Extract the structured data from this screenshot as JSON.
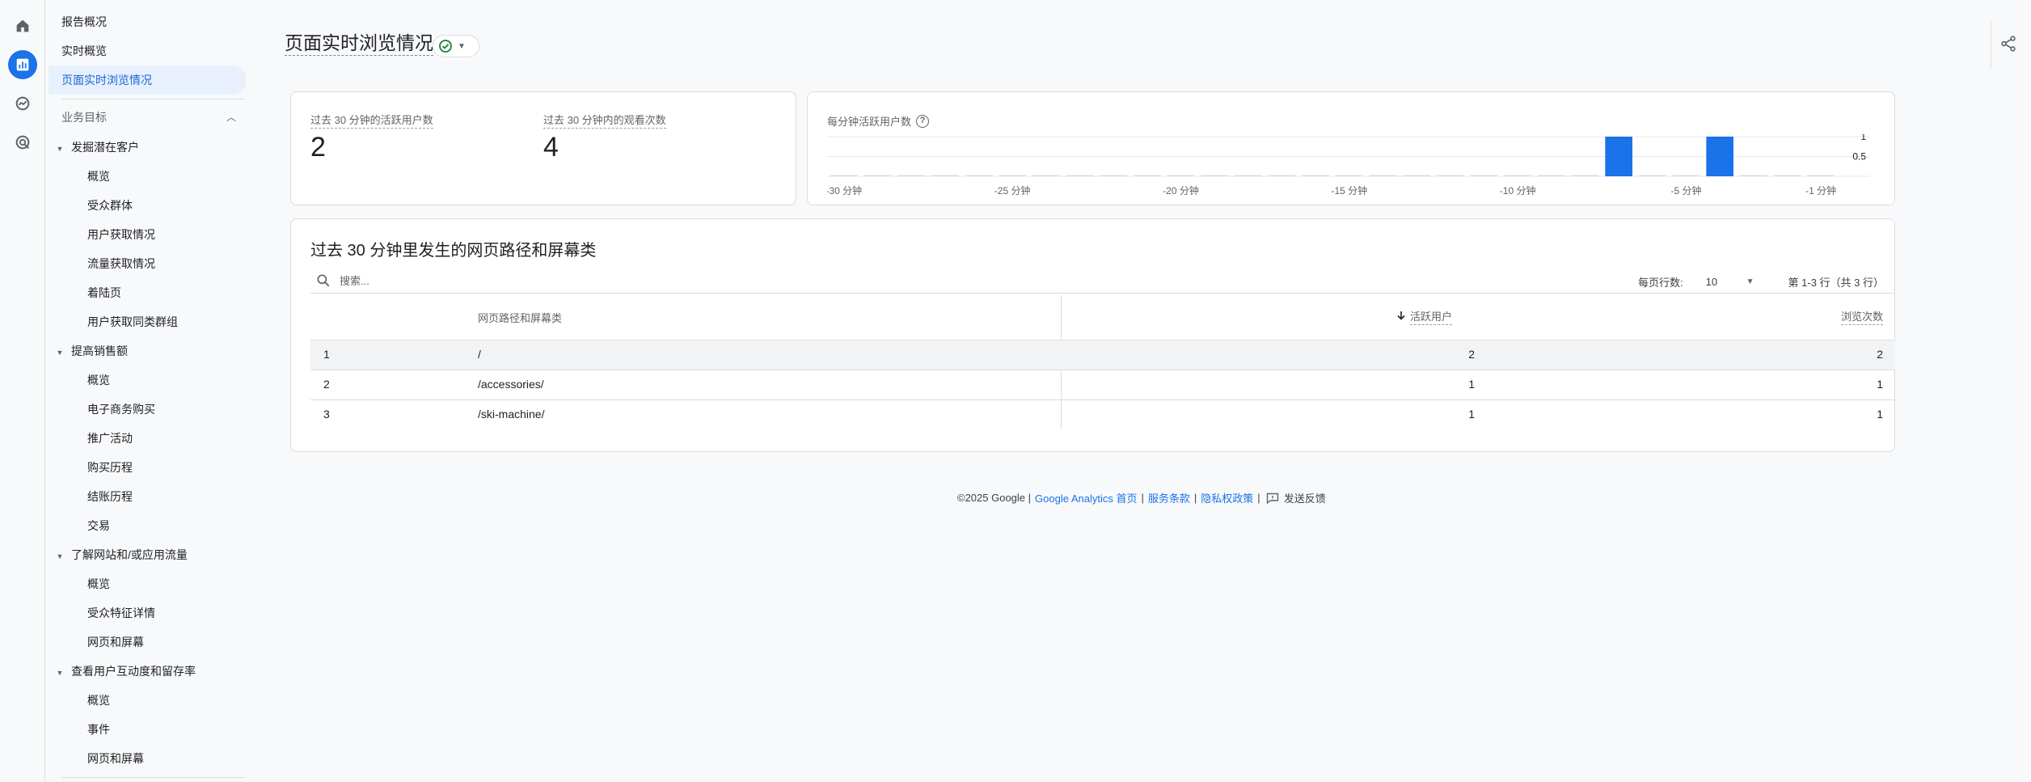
{
  "rail": {
    "icons": [
      "home-icon",
      "reports-icon",
      "explore-icon",
      "advertising-icon"
    ]
  },
  "nav": {
    "top": [
      "报告概况",
      "实时概览",
      "页面实时浏览情况"
    ],
    "section": "业务目标",
    "groups": [
      {
        "label": "发掘潜在客户",
        "items": [
          "概览",
          "受众群体",
          "用户获取情况",
          "流量获取情况",
          "着陆页",
          "用户获取同类群组"
        ]
      },
      {
        "label": "提高销售额",
        "items": [
          "概览",
          "电子商务购买",
          "推广活动",
          "购买历程",
          "结账历程",
          "交易"
        ]
      },
      {
        "label": "了解网站和/或应用流量",
        "items": [
          "概览",
          "受众特征详情",
          "网页和屏幕"
        ]
      },
      {
        "label": "查看用户互动度和留存率",
        "items": [
          "概览",
          "事件",
          "网页和屏幕"
        ]
      }
    ]
  },
  "header": {
    "title": "页面实时浏览情况"
  },
  "metrics": {
    "users_label": "过去 30 分钟的活跃用户数",
    "users_value": "2",
    "views_label": "过去 30 分钟内的观看次数",
    "views_value": "4"
  },
  "chart_data": {
    "type": "bar",
    "title": "每分钟活跃用户数",
    "x": [
      -30,
      -29,
      -28,
      -27,
      -26,
      -25,
      -24,
      -23,
      -22,
      -21,
      -20,
      -19,
      -18,
      -17,
      -16,
      -15,
      -14,
      -13,
      -12,
      -11,
      -10,
      -9,
      -8,
      -7,
      -6,
      -5,
      -4,
      -3,
      -2,
      -1
    ],
    "values": [
      0,
      0,
      0,
      0,
      0,
      0,
      0,
      0,
      0,
      0,
      0,
      0,
      0,
      0,
      0,
      0,
      0,
      0,
      0,
      0,
      0,
      0,
      0,
      1,
      0,
      0,
      1,
      0,
      0,
      0
    ],
    "xticks": [
      "-30 分钟",
      "-25 分钟",
      "-20 分钟",
      "-15 分钟",
      "-10 分钟",
      "-5 分钟",
      "-1 分钟"
    ],
    "yticks": [
      "1",
      "0.5"
    ],
    "ylim": [
      0,
      1
    ],
    "color": "#1a73e8"
  },
  "table": {
    "title": "过去 30 分钟里发生的网页路径和屏幕类",
    "search_placeholder": "搜索...",
    "rows_per_page_label": "每页行数:",
    "rows_per_page_value": "10",
    "range_text": "第 1-3 行（共 3 行）",
    "columns": [
      "网页路径和屏幕类",
      "活跃用户",
      "浏览次数"
    ],
    "rows": [
      {
        "index": "1",
        "path": "/",
        "users": "2",
        "views": "2"
      },
      {
        "index": "2",
        "path": "/accessories/",
        "users": "1",
        "views": "1"
      },
      {
        "index": "3",
        "path": "/ski-machine/",
        "users": "1",
        "views": "1"
      }
    ]
  },
  "footer": {
    "copyright": "©2025 Google |",
    "home_link": "Google Analytics 首页",
    "terms_link": "服务条款",
    "privacy_link": "隐私权政策",
    "feedback": "发送反馈"
  }
}
